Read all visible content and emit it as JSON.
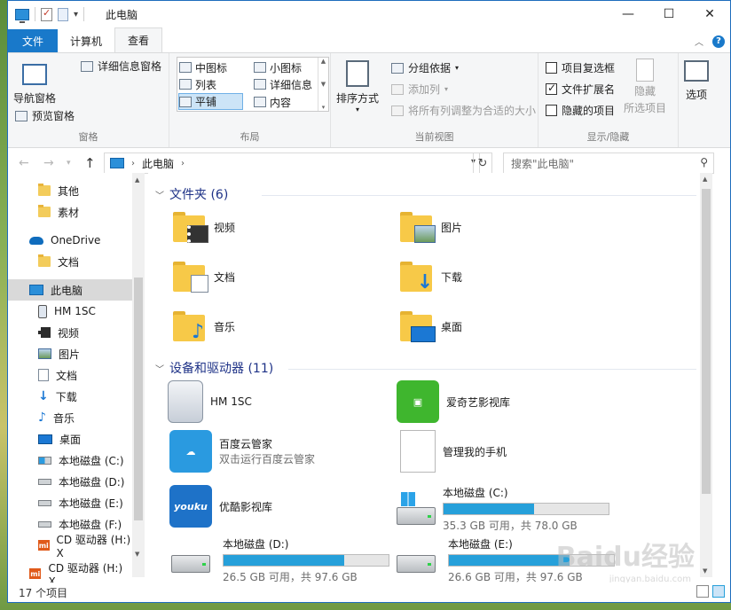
{
  "titlebar": {
    "title": "此电脑",
    "minimize": "—",
    "maximize": "☐",
    "close": "✕"
  },
  "tabs": {
    "file": "文件",
    "computer": "计算机",
    "view": "查看"
  },
  "ribbon": {
    "panes": {
      "nav_pane": "导航窗格",
      "preview_pane": "预览窗格",
      "details_pane": "详细信息窗格",
      "label": "窗格"
    },
    "layout": {
      "items": [
        "中图标",
        "小图标",
        "列表",
        "详细信息",
        "平铺",
        "内容"
      ],
      "label": "布局"
    },
    "current_view": {
      "sort": "排序方式",
      "group_by": "分组依据",
      "add_column": "添加列",
      "fit_columns": "将所有列调整为合适的大小",
      "label": "当前视图"
    },
    "show_hide": {
      "item_checkboxes": "项目复选框",
      "file_extensions": "文件扩展名",
      "hidden_items": "隐藏的项目",
      "hide": "隐藏",
      "hide_selected": "所选项目",
      "label": "显示/隐藏"
    },
    "options": "选项"
  },
  "address": {
    "crumb": "此电脑",
    "search_placeholder": "搜索\"此电脑\""
  },
  "sidebar": {
    "items": [
      {
        "label": "其他",
        "icon": "folder-icon"
      },
      {
        "label": "素材",
        "icon": "folder-icon"
      },
      {
        "label": "OneDrive",
        "icon": "onedrive-icon"
      },
      {
        "label": "文档",
        "icon": "folder-icon"
      },
      {
        "label": "此电脑",
        "icon": "computer-icon"
      },
      {
        "label": "HM 1SC",
        "icon": "phone-icon"
      },
      {
        "label": "视频",
        "icon": "video-icon"
      },
      {
        "label": "图片",
        "icon": "picture-icon"
      },
      {
        "label": "文档",
        "icon": "document-icon"
      },
      {
        "label": "下载",
        "icon": "download-icon"
      },
      {
        "label": "音乐",
        "icon": "music-icon"
      },
      {
        "label": "桌面",
        "icon": "desktop-icon"
      },
      {
        "label": "本地磁盘 (C:)",
        "icon": "drive-c-icon"
      },
      {
        "label": "本地磁盘 (D:)",
        "icon": "drive-icon"
      },
      {
        "label": "本地磁盘 (E:)",
        "icon": "drive-icon"
      },
      {
        "label": "本地磁盘 (F:)",
        "icon": "drive-icon"
      },
      {
        "label": "CD 驱动器 (H:) X",
        "icon": "cd-drive-icon"
      },
      {
        "label": "CD 驱动器 (H:) X",
        "icon": "cd-drive-icon"
      }
    ]
  },
  "content": {
    "folders_header": "文件夹 (6)",
    "folders": [
      {
        "label": "视频",
        "badge": "video"
      },
      {
        "label": "图片",
        "badge": "picture"
      },
      {
        "label": "文档",
        "badge": "document"
      },
      {
        "label": "下载",
        "badge": "download"
      },
      {
        "label": "音乐",
        "badge": "music"
      },
      {
        "label": "桌面",
        "badge": "desktop"
      }
    ],
    "devices_header": "设备和驱动器 (11)",
    "devices": [
      {
        "label": "HM 1SC",
        "sub": ""
      },
      {
        "label": "爱奇艺影视库",
        "sub": ""
      },
      {
        "label": "百度云管家",
        "sub": "双击运行百度云管家"
      },
      {
        "label": "管理我的手机",
        "sub": ""
      },
      {
        "label": "优酷影视库",
        "sub": ""
      }
    ],
    "drives": [
      {
        "label": "本地磁盘 (C:)",
        "free": "35.3 GB 可用，共 78.0 GB",
        "used_fraction": 0.55
      },
      {
        "label": "本地磁盘 (D:)",
        "free": "26.5 GB 可用，共 97.6 GB",
        "used_fraction": 0.73
      },
      {
        "label": "本地磁盘 (E:)",
        "free": "26.6 GB 可用，共 97.6 GB",
        "used_fraction": 0.73
      }
    ]
  },
  "status": {
    "count": "17 个项目"
  },
  "watermark": {
    "main": "Baidu经验",
    "sub": "jingyan.baidu.com"
  },
  "colors": {
    "accent": "#1979ca",
    "drive_bar": "#26a0da",
    "section_header": "#1e3287"
  }
}
